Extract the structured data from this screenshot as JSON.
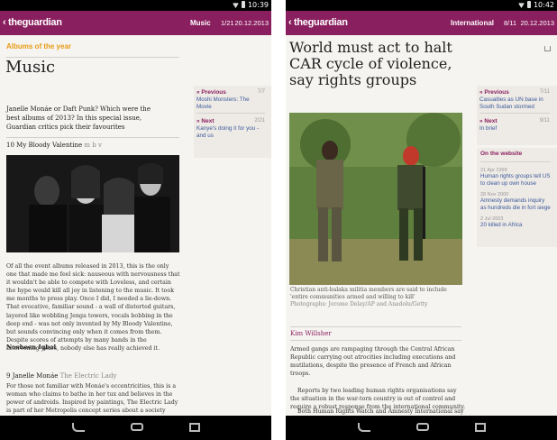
{
  "status_left": {
    "time": "10:39"
  },
  "status_right": {
    "time": "10:42"
  },
  "left": {
    "appbar": {
      "back": "‹",
      "logo": "theguardian",
      "section": "Music",
      "count": "1/21",
      "date": "20.12.2013"
    },
    "kicker": "Albums of the year",
    "title": "Music",
    "standfirst": "Janelle Monáe or Daft Punk? Which were the best albums of 2013? In this special issue, Guardian critics pick their favourites",
    "item10": {
      "rank": "10",
      "artist": "My Bloody Valentine",
      "album": "m b v"
    },
    "body10": "Of all the event albums released in 2013, this is the only one that made me feel sick: nauseous with nervousness that it wouldn't be able to compete with Loveless, and certain the hype would kill all joy in listening to the music. It took me months to press play. Once I did, I needed a lie-down. That evocative, familiar sound - a wall of distorted guitars, layered like wobbling Jenga towers, vocals bobbing in the deep end - was not only invented by My Bloody Valentine, but sounds convincing only when it comes from them. Despite scores of attempts by many bands in the intervening years, nobody else has really achieved it.",
    "author10": "Nosheen Iqbal",
    "item9": {
      "rank": "9",
      "artist": "Janelle Monáe",
      "album": "The Electric Lady"
    },
    "body9": "For those not familiar with Monáe's eccentricities, this is a woman who claims to bathe in her tux and believes in the power of androids. Inspired by paintings, The Electric Lady is part of her Metropolis concept series about a society from the",
    "previous": {
      "label": "Previous",
      "num": "7/7",
      "text": "Moshi Monsters: The Movie"
    },
    "next": {
      "label": "Next",
      "num": "2/21",
      "text": "Kanye's doing it for you - and us"
    }
  },
  "right": {
    "appbar": {
      "back": "‹",
      "logo": "theguardian",
      "section": "International",
      "count": "8/11",
      "date": "20.12.2013"
    },
    "title": "World must act to halt CAR cycle of violence, say rights groups",
    "caption": "Christian anti-balaka militia members are said to include 'entire communities armed and willing to kill'",
    "photo_credit": "Photographs: Jerome Delay/AP and Anadolu/Getty",
    "byline": "Kim Willsher",
    "body": "Armed gangs are rampaging through the Central African Republic carrying out atrocities including executions and mutilations, despite the presence of French and African troops.",
    "body2": "Reports by two leading human rights organisations say the situation in the war-torn country is out of control and require a robust response from the international community.",
    "body3": "Both Human Rights Watch and Amnesty International say",
    "previous": {
      "label": "Previous",
      "num": "7/11",
      "text": "Casualties as UN base in South Sudan stormed"
    },
    "next": {
      "label": "Next",
      "num": "9/11",
      "text": "In brief"
    },
    "onweb": {
      "title": "On the website",
      "items": [
        {
          "date": "21 Apr 1999",
          "text": "Human rights groups tell US to clean up own house"
        },
        {
          "date": "28 Nov 2000",
          "text": "Amnesty demands inquiry as hundreds die in fort siege"
        },
        {
          "date": "2 Jul 2003",
          "text": "20 killed in Africa"
        }
      ]
    }
  }
}
